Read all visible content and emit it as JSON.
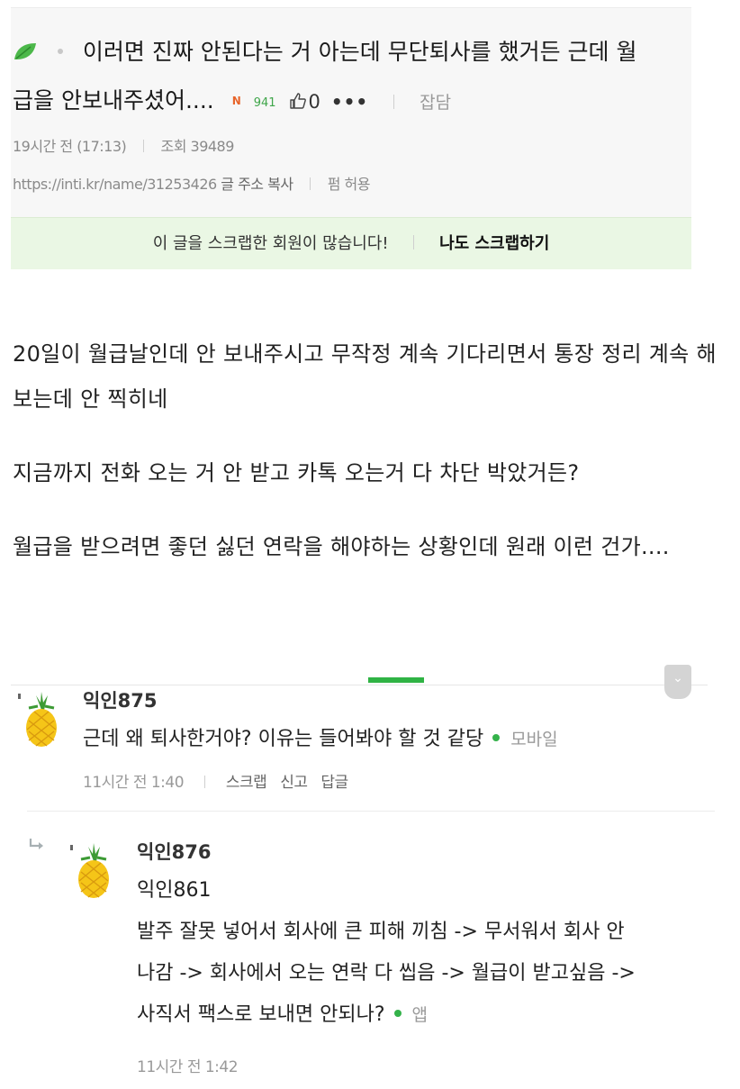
{
  "post": {
    "title_line1": "이러면 진짜 안된다는 거 아는데 무단퇴사를 했거든 근데 월",
    "title_line2": "급을 안보내주셨어....",
    "new_badge": "N",
    "views_badge": "941",
    "likes": "0",
    "more": "•••",
    "category": "잡담",
    "time": "19시간 전 (17:13)",
    "views": "조회 39489",
    "url": "https://inti.kr/name/31253426",
    "copy_url": "글 주소 복사",
    "repost": "펌 허용",
    "scrap_msg": "이 글을 스크랩한 회원이 많습니다!",
    "scrap_btn": "나도 스크랩하기",
    "body": [
      "20일이 월급날인데 안 보내주시고 무작정 계속 기다리면서 통장 정리 계속 해보는데 안 찍히네",
      "지금까지 전화 오는 거 안 받고 카톡 오는거 다 차단 박았거든?",
      "월급을 받으려면 좋던 싫던 연락을 해야하는 상황인데 원래 이런 건가...."
    ]
  },
  "comments": [
    {
      "nick": "익인875",
      "text": "근데 왜 퇴사한거야? 이유는 들어봐야 할 것 같당",
      "device": "모바일",
      "time": "11시간 전 1:40",
      "scrap": "스크랩",
      "report": "신고",
      "reply": "답글"
    }
  ],
  "reply": {
    "nick": "익인876",
    "mention": "익인861",
    "line1": "발주 잘못 넣어서 회사에 큰 피해 끼침 -> 무서워서 회사 안",
    "line2": "나감 -> 회사에서 오는 연락 다 씹음 -> 월급이 받고싶음 ->",
    "line3": "사직서 팩스로 보내면 안되나?",
    "device": "앱",
    "time": "11시간 전 1:42"
  },
  "colors": {
    "accent": "#2fb344",
    "scrap_bg": "#eaf7e4"
  },
  "icons": [
    "leaf-icon",
    "thumbs-up-icon",
    "chevron-down-icon",
    "pineapple-avatar-icon",
    "reply-arrow-icon"
  ]
}
